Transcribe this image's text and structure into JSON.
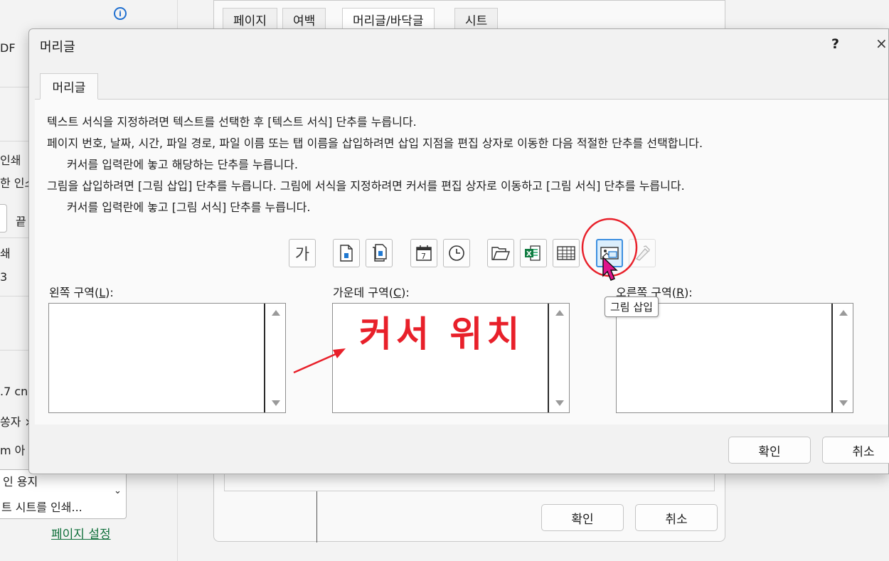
{
  "background": {
    "page_setup": {
      "tabs": [
        "페이지",
        "여백",
        "머리글/바닥글",
        "시트"
      ],
      "active_tab": "머리글/바닥글",
      "ok_label": "확인",
      "cancel_label": "취소"
    },
    "print_pane": {
      "partial_texts": [
        "DF",
        "인쇄",
        "한 인소",
        "끝",
        "쇄",
        "3",
        ".7 cn",
        "쏭자 ×",
        "m 아",
        "인 용지",
        "트 시트를 인쇄..."
      ],
      "page_setup_link": "페이지 설정"
    }
  },
  "dialog": {
    "title": "머리글",
    "help": "?",
    "close": "×",
    "tab": "머리글",
    "instructions": [
      "텍스트 서식을 지정하려면 텍스트를 선택한 후 [텍스트 서식] 단추를 누릅니다.",
      "페이지 번호, 날짜, 시간, 파일 경로, 파일 이름 또는 탭 이름을 삽입하려면 삽입 지점을 편집 상자로 이동한 다음 적절한 단추를 선택합니다.",
      "커서를 입력란에 놓고 해당하는 단추를 누릅니다.",
      "그림을 삽입하려면 [그림 삽입] 단추를 누릅니다.  그림에 서식을 지정하려면 커서를 편집 상자로 이동하고 [그림 서식] 단추를 누릅니다.",
      "커서를 입력란에 놓고 [그림 서식] 단추를 누릅니다."
    ],
    "toolbar": {
      "format_text_glyph": "가",
      "icons": [
        "format-text-icon",
        "page-number-icon",
        "total-pages-icon",
        "date-icon",
        "time-icon",
        "file-path-icon",
        "file-name-icon",
        "sheet-name-icon",
        "insert-picture-icon",
        "format-picture-icon"
      ],
      "tooltip": "그림 삽입"
    },
    "sections": {
      "left": {
        "label": "왼쪽 구역",
        "hotkey": "L",
        "value": ""
      },
      "center": {
        "label": "가운데 구역",
        "hotkey": "C",
        "value": ""
      },
      "right": {
        "label": "오른쪽 구역",
        "hotkey": "R",
        "value": ""
      }
    },
    "ok_label": "확인",
    "cancel_label": "취소"
  },
  "annotation": {
    "text": "커서 위치",
    "color": "#e8202a"
  }
}
